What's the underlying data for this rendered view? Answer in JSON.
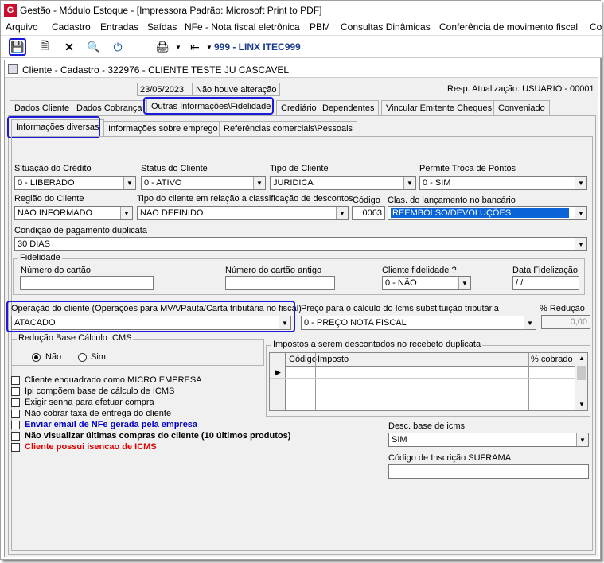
{
  "app": {
    "title": "Gestão  - Módulo Estoque - [Impressora Padrão: Microsoft Print to PDF]"
  },
  "menu": [
    "Arquivo",
    "Cadastro",
    "Entradas",
    "Saídas",
    "NFe - Nota fiscal eletrônica",
    "PBM",
    "Consultas Dinâmicas",
    "Conferência de movimento fiscal",
    "Co"
  ],
  "toolbar": {
    "company": "999 - LINX ITEC999"
  },
  "window": {
    "title": "Cliente - Cadastro - 322976 - CLIENTE TESTE JU CASCAVEL"
  },
  "status": {
    "date": "23/05/2023",
    "change": "Não houve alteração",
    "resp": "Resp. Atualização: USUARIO - 00001"
  },
  "tabs_top": [
    "Dados Cliente",
    "Dados Cobrança",
    "Outras Informações\\Fidelidade",
    "Crediário",
    "Dependentes",
    "Vincular Emitente Cheques",
    "Conveniado"
  ],
  "tabs_sub": [
    "Informações diversas",
    "Informações sobre emprego",
    "Referências comerciais\\Pessoais"
  ],
  "form": {
    "situacao_label": "Situação do Crédito",
    "situacao_value": "0 - LIBERADO",
    "status_label": "Status do Cliente",
    "status_value": "0 - ATIVO",
    "tipo_label": "Tipo de Cliente",
    "tipo_value": "JURIDICA",
    "troca_label": "Permite Troca de Pontos",
    "troca_value": "0 - SIM",
    "regiao_label": "Região do Cliente",
    "regiao_value": "NAO INFORMADO",
    "tipodesc_label": "Tipo do cliente em relação a classificação de descontos",
    "tipodesc_value": "NAO DEFINIDO",
    "codigo_label": "Código",
    "codigo_value": "0063",
    "clas_label": "Clas. do lançamento no bancário",
    "clas_value": "REEMBOLSO/DEVOLUÇÕES",
    "cond_label": "Condição de pagamento duplicata",
    "cond_value": "30 DIAS",
    "fid_group": "Fidelidade",
    "cartao_label": "Número do cartão",
    "cartao_value": "",
    "cartao_ant_label": "Número do cartão antigo",
    "cartao_ant_value": "",
    "cli_fid_label": "Cliente fidelidade ?",
    "cli_fid_value": "0 - NÃO",
    "data_fid_label": "Data Fidelização",
    "data_fid_value": " /  /",
    "operacao_label": "Operação do cliente (Operações para MVA/Pauta/Carta tributária no fiscal)",
    "operacao_value": "ATACADO",
    "preco_label": "Preço para o cálculo do Icms substituição tributária",
    "preco_value": "0 - PREÇO NOTA FISCAL",
    "reducao_label": "% Redução",
    "reducao_value": "0,00",
    "red_group": "Redução Base Cálculo ICMS",
    "red_nao": "Não",
    "red_sim": "Sim",
    "impostos_group": "Impostos a serem descontados no recebeto duplicata",
    "imp_cols": [
      "Código",
      "Imposto",
      "% cobrado"
    ],
    "checks": [
      "Cliente enquadrado como MICRO EMPRESA",
      "Ipi compõem base de cálculo de ICMS",
      "Exigir senha para efetuar compra",
      "Não cobrar taxa de entrega do cliente",
      "Enviar email de NFe gerada pela empresa",
      "Não visualizar últimas compras do cliente (10 últimos produtos)",
      "Cliente possui isencao de ICMS"
    ],
    "desc_label": "Desc. base de icms",
    "desc_value": "SIM",
    "suframa_label": "Código de Inscrição SUFRAMA",
    "suframa_value": ""
  },
  "colors": {
    "highlight": "#1a1ad8",
    "blue_text": "#0000c8",
    "red_text": "#e00000",
    "selection": "#0a64d8"
  }
}
